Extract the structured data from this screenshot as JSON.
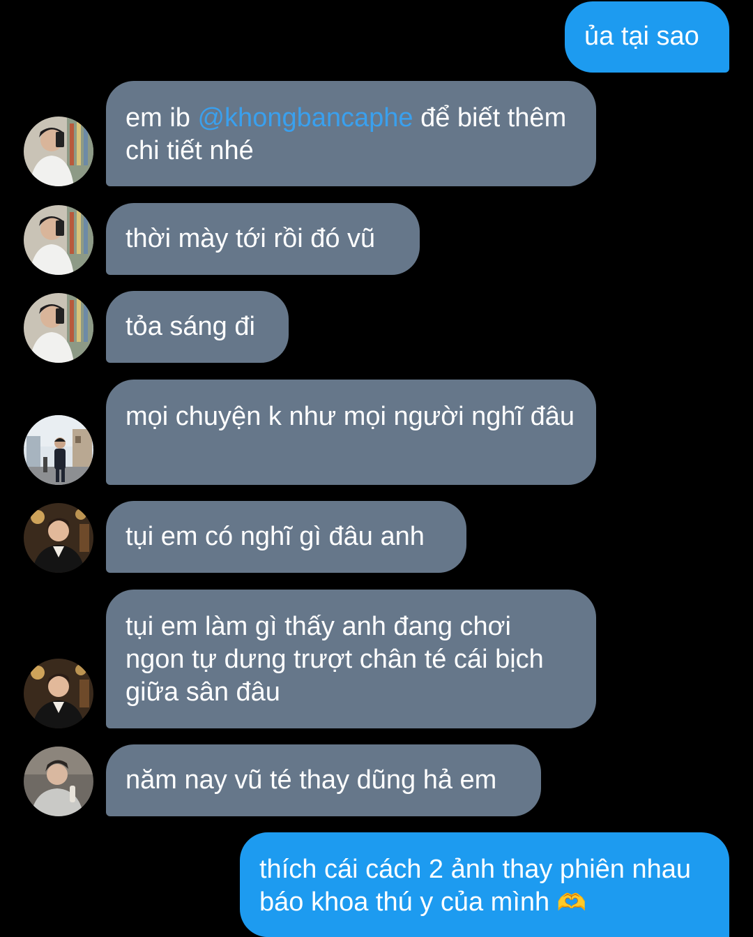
{
  "colors": {
    "background": "#000000",
    "incoming_bubble": "#66778a",
    "outgoing_bubble": "#1d9bf0",
    "mention": "#3aa0ee",
    "text": "#ffffff"
  },
  "messages": [
    {
      "direction": "outgoing",
      "text": "ủa tại sao"
    },
    {
      "direction": "incoming",
      "avatar": "avatar-mirror-selfie",
      "text_before": "em ib ",
      "mention": "@khongbancaphe",
      "text_after": " để biết thêm chi tiết nhé"
    },
    {
      "direction": "incoming",
      "avatar": "avatar-mirror-selfie",
      "text": "thời mày tới rồi đó vũ"
    },
    {
      "direction": "incoming",
      "avatar": "avatar-mirror-selfie",
      "text": "tỏa sáng đi"
    },
    {
      "direction": "incoming",
      "avatar": "avatar-street-photo",
      "text": "mọi chuyện k như mọi người nghĩ đâu"
    },
    {
      "direction": "incoming",
      "avatar": "avatar-warm-portrait",
      "text": "tụi em có nghĩ gì đâu anh"
    },
    {
      "direction": "incoming",
      "avatar": "avatar-warm-portrait",
      "text": "tụi em làm gì thấy anh đang chơi ngon tự dưng trượt chân té cái bịch giữa sân đâu"
    },
    {
      "direction": "incoming",
      "avatar": "avatar-gray-portrait",
      "text": "năm nay vũ té thay dũng hả em"
    },
    {
      "direction": "outgoing",
      "text": "thích cái cách 2 ảnh thay phiên nhau báo khoa thú y của mình",
      "emoji": "🫶",
      "emoji_name": "heart-hands-emoji"
    }
  ]
}
